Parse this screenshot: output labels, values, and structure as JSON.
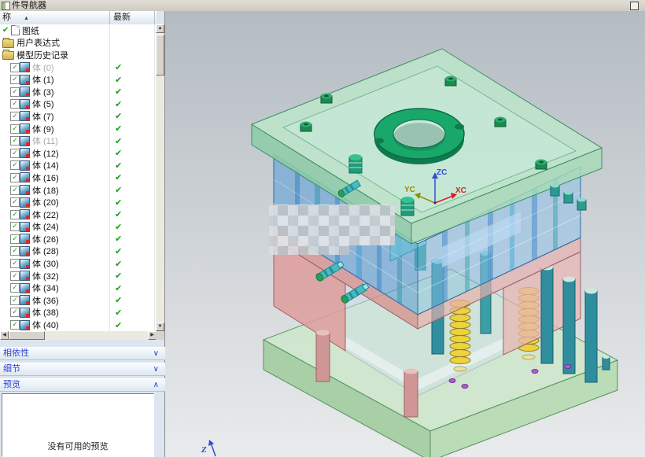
{
  "panel": {
    "title": "件导航器",
    "header": {
      "name_col": "称",
      "latest_col": "最新",
      "sort_indicator": "▲"
    },
    "checkbox_glyph": "✓",
    "root_items": [
      {
        "label": "图纸",
        "icon": "sheet",
        "prefix_check": "✔"
      },
      {
        "label": "用户表达式",
        "icon": "folder"
      },
      {
        "label": "模型历史记录",
        "icon": "folder"
      }
    ],
    "body_items": [
      {
        "label": "体 (0)",
        "muted": true,
        "latest": "✔"
      },
      {
        "label": "体 (1)",
        "muted": false,
        "latest": "✔"
      },
      {
        "label": "体 (3)",
        "muted": false,
        "latest": "✔"
      },
      {
        "label": "体 (5)",
        "muted": false,
        "latest": "✔"
      },
      {
        "label": "体 (7)",
        "muted": false,
        "latest": "✔"
      },
      {
        "label": "体 (9)",
        "muted": false,
        "latest": "✔"
      },
      {
        "label": "体 (11)",
        "muted": true,
        "latest": "✔"
      },
      {
        "label": "体 (12)",
        "muted": false,
        "latest": "✔"
      },
      {
        "label": "体 (14)",
        "muted": false,
        "latest": "✔"
      },
      {
        "label": "体 (16)",
        "muted": false,
        "latest": "✔"
      },
      {
        "label": "体 (18)",
        "muted": false,
        "latest": "✔"
      },
      {
        "label": "体 (20)",
        "muted": false,
        "latest": "✔"
      },
      {
        "label": "体 (22)",
        "muted": false,
        "latest": "✔"
      },
      {
        "label": "体 (24)",
        "muted": false,
        "latest": "✔"
      },
      {
        "label": "体 (26)",
        "muted": false,
        "latest": "✔"
      },
      {
        "label": "体 (28)",
        "muted": false,
        "latest": "✔"
      },
      {
        "label": "体 (30)",
        "muted": false,
        "latest": "✔"
      },
      {
        "label": "体 (32)",
        "muted": false,
        "latest": "✔"
      },
      {
        "label": "体 (34)",
        "muted": false,
        "latest": "✔"
      },
      {
        "label": "体 (36)",
        "muted": false,
        "latest": "✔"
      },
      {
        "label": "体 (38)",
        "muted": false,
        "latest": "✔"
      },
      {
        "label": "体 (40)",
        "muted": false,
        "latest": "✔"
      }
    ],
    "sections": [
      {
        "label": "相依性",
        "chevron": "∨"
      },
      {
        "label": "细节",
        "chevron": "∨"
      },
      {
        "label": "预览",
        "chevron": "∧"
      }
    ],
    "preview_empty_text": "没有可用的预览"
  },
  "glyphs": {
    "scroll_up": "▲",
    "scroll_down": "▼",
    "scroll_left": "◀",
    "scroll_right": "▶"
  },
  "viewport": {
    "axes": {
      "z": "ZC",
      "y": "YC",
      "x": "XC"
    },
    "corner_axis": "Z",
    "model": "injection-mold-assembly"
  },
  "colors": {
    "latest_check": "#17a017",
    "section_text": "#2b3fd0",
    "axis_x": "#d02020",
    "axis_y": "#8f8f00",
    "axis_z": "#3050d0"
  }
}
